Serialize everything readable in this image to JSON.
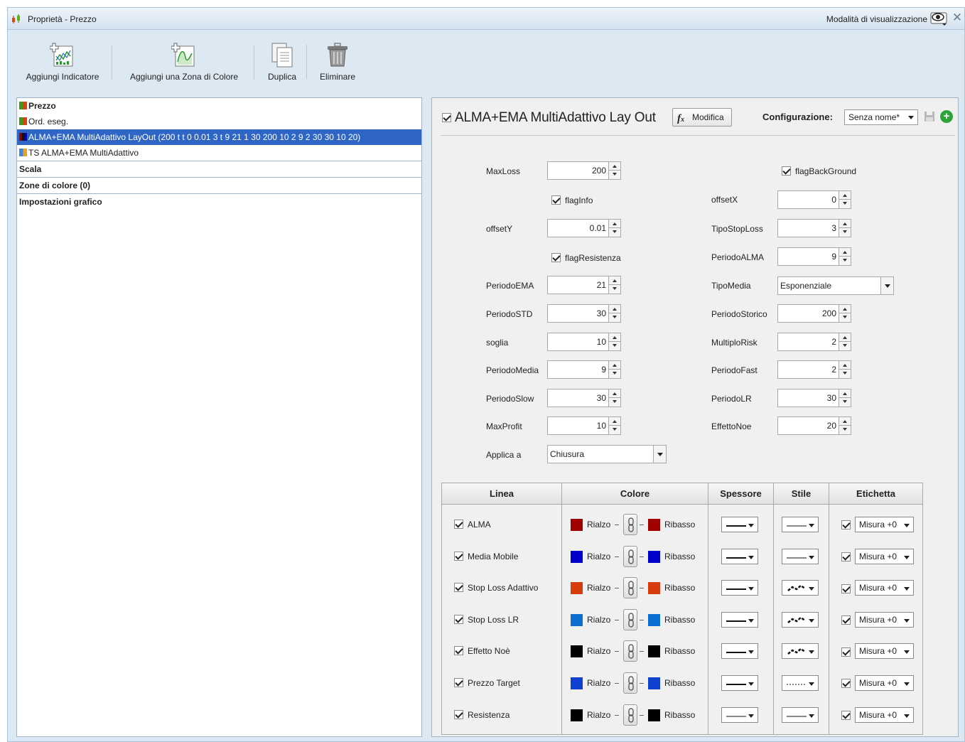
{
  "window": {
    "title": "Proprietà - Prezzo",
    "view_mode": "Modalità di visualizzazione"
  },
  "toolbar": {
    "add_indicator": "Aggiungi Indicatore",
    "add_color_zone": "Aggiungi una Zona di Colore",
    "duplicate": "Duplica",
    "delete": "Eliminare"
  },
  "tree": {
    "items": [
      {
        "label": "Prezzo"
      },
      {
        "label": "Ord. eseg."
      },
      {
        "label": "ALMA+EMA MultiAdattivo LayOut (200 t t 0 0.01 3 t 9 21 1 30 200 10 2 9 2 30 30 10 20)"
      },
      {
        "label": "TS ALMA+EMA MultiAdattivo"
      }
    ],
    "sections": [
      "Scala",
      "Zone di colore (0)",
      "Impostazioni grafico"
    ]
  },
  "indicator": {
    "title": "ALMA+EMA MultiAdattivo Lay Out",
    "modify_label": "Modifica",
    "config_label": "Configurazione:",
    "config_value": "Senza nome*"
  },
  "params": {
    "MaxLoss": {
      "label": "MaxLoss",
      "value": "200"
    },
    "flagBackGround": {
      "label": "flagBackGround"
    },
    "flagInfo": {
      "label": "flagInfo"
    },
    "offsetX": {
      "label": "offsetX",
      "value": "0"
    },
    "offsetY": {
      "label": "offsetY",
      "value": "0.01"
    },
    "TipoStopLoss": {
      "label": "TipoStopLoss",
      "value": "3"
    },
    "flagResistenza": {
      "label": "flagResistenza"
    },
    "PeriodoALMA": {
      "label": "PeriodoALMA",
      "value": "9"
    },
    "PeriodoEMA": {
      "label": "PeriodoEMA",
      "value": "21"
    },
    "TipoMedia": {
      "label": "TipoMedia",
      "value": "Esponenziale"
    },
    "PeriodoSTD": {
      "label": "PeriodoSTD",
      "value": "30"
    },
    "PeriodoStorico": {
      "label": "PeriodoStorico",
      "value": "200"
    },
    "soglia": {
      "label": "soglia",
      "value": "10"
    },
    "MultiploRisk": {
      "label": "MultiploRisk",
      "value": "2"
    },
    "PeriodoMedia": {
      "label": "PeriodoMedia",
      "value": "9"
    },
    "PeriodoFast": {
      "label": "PeriodoFast",
      "value": "2"
    },
    "PeriodoSlow": {
      "label": "PeriodoSlow",
      "value": "30"
    },
    "PeriodoLR": {
      "label": "PeriodoLR",
      "value": "30"
    },
    "MaxProfit": {
      "label": "MaxProfit",
      "value": "10"
    },
    "EffettoNoe": {
      "label": "EffettoNoe",
      "value": "20"
    },
    "ApplicaA": {
      "label": "Applica a",
      "value": "Chiusura"
    }
  },
  "lines_table": {
    "headers": [
      "Linea",
      "Colore",
      "Spessore",
      "Stile",
      "Etichetta"
    ],
    "up_label": "Rialzo",
    "down_label": "Ribasso",
    "label_value": "Misura +0",
    "rows": [
      {
        "name": "ALMA",
        "color_up": "#a00000",
        "color_down": "#a00000"
      },
      {
        "name": "Media Mobile",
        "color_up": "#0000cc",
        "color_down": "#0000cc"
      },
      {
        "name": "Stop Loss Adattivo",
        "color_up": "#d83c0c",
        "color_down": "#d83c0c"
      },
      {
        "name": "Stop Loss LR",
        "color_up": "#0a6fd0",
        "color_down": "#0a6fd0"
      },
      {
        "name": "Effetto Noè",
        "color_up": "#000000",
        "color_down": "#000000"
      },
      {
        "name": "Prezzo Target",
        "color_up": "#1040d0",
        "color_down": "#1040d0"
      },
      {
        "name": "Resistenza",
        "color_up": "#000000",
        "color_down": "#000000"
      }
    ]
  },
  "colors": {
    "selection": "#2f66c6",
    "accent_green": "#2fa33a"
  }
}
